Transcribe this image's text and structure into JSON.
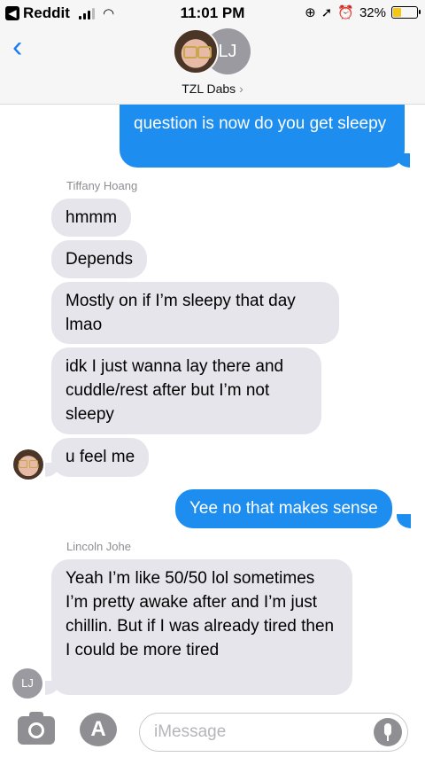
{
  "status_bar": {
    "back_app": "Reddit",
    "time": "11:01 PM",
    "battery": "32%"
  },
  "header": {
    "avatar_initials": "LJ",
    "group_name": "TZL Dabs",
    "chevron": "›"
  },
  "messages": {
    "out1": "question is now do you get sleepy",
    "sender1": "Tiffany Hoang",
    "in1": "hmmm",
    "in2": "Depends",
    "in3": "Mostly on if I’m sleepy that day lmao",
    "in4": "idk I just wanna lay there and cuddle/rest after but I’m not sleepy",
    "in5": "u feel me",
    "out2": "Yee no that makes sense",
    "sender2": "Lincoln Johe",
    "in6": "Yeah I’m like 50/50 lol sometimes I’m pretty awake after and I’m just chillin. But if I was already tired then I could be more tired",
    "lj_initials": "LJ"
  },
  "composer": {
    "placeholder": "iMessage",
    "appstore_glyph": "A"
  },
  "colors": {
    "outgoing": "#1d8df0",
    "incoming": "#e6e5eb",
    "accent": "#1a7cf5"
  }
}
